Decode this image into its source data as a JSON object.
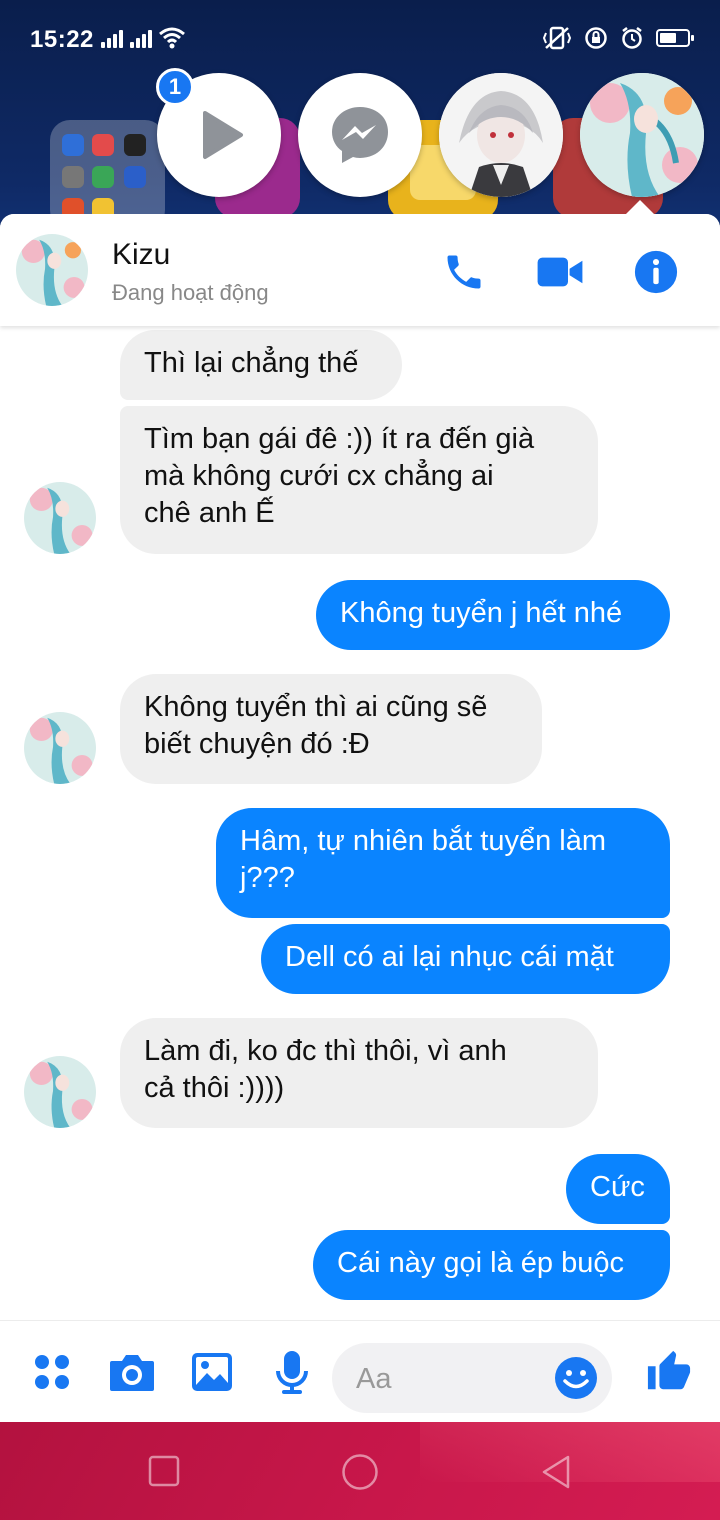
{
  "status_bar": {
    "time": "15:22",
    "battery_percent": 50
  },
  "chat_heads": {
    "badge_count": "1"
  },
  "header": {
    "name": "Kizu",
    "status": "Đang hoạt động"
  },
  "messages": [
    {
      "side": "in",
      "text": "Thì lại chẳng thế"
    },
    {
      "side": "in",
      "text": "Tìm bạn gái đê :)) ít ra đến già\nmà không cưới cx chẳng ai\nchê anh Ế"
    },
    {
      "side": "out",
      "text": "Không tuyển j hết nhé"
    },
    {
      "side": "in",
      "text": "Không tuyển thì ai cũng sẽ\nbiết chuyện đó :Đ"
    },
    {
      "side": "out",
      "text": "Hâm, tự nhiên bắt tuyển làm\nj???"
    },
    {
      "side": "out",
      "text": "Dell có ai lại nhục cái mặt"
    },
    {
      "side": "in",
      "text": "Làm đi, ko đc thì thôi, vì anh\ncả thôi :))))"
    },
    {
      "side": "out",
      "text": "Cức"
    },
    {
      "side": "out",
      "text": "Cái này gọi là ép buộc"
    }
  ],
  "composer": {
    "placeholder": "Aa"
  },
  "icons": {
    "call": "phone-icon",
    "video": "video-camera-icon",
    "info": "info-icon",
    "menu": "four-dots-icon",
    "camera": "camera-icon",
    "gallery": "image-icon",
    "mic": "microphone-icon",
    "emoji": "smiley-icon",
    "like": "thumbs-up-icon"
  },
  "colors": {
    "accent": "#0a84ff",
    "incoming_bubble": "#efefef",
    "icon_blue": "#1877f2"
  }
}
